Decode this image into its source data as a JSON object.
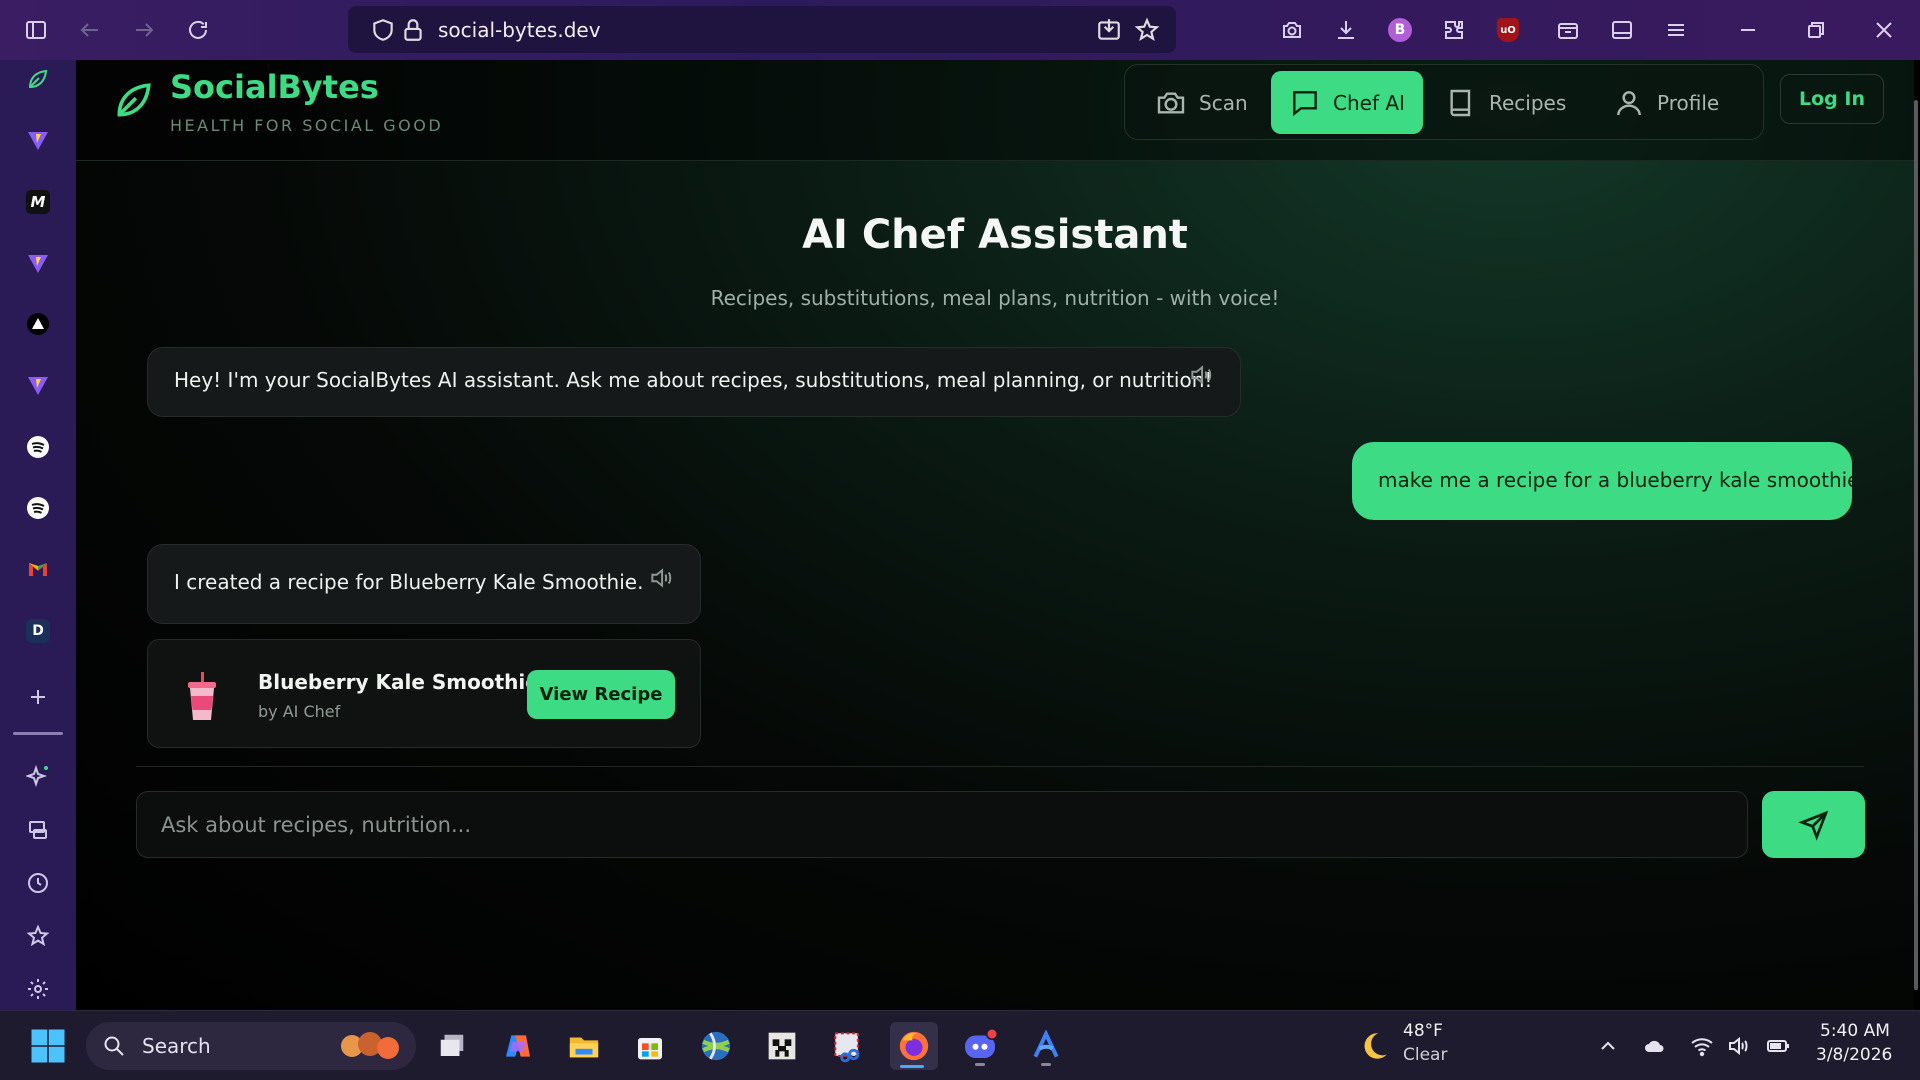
{
  "browser": {
    "url": "social-bytes.dev"
  },
  "app": {
    "brand": {
      "name": "SocialBytes",
      "tagline": "HEALTH FOR SOCIAL GOOD"
    },
    "nav": {
      "items": [
        {
          "label": "Scan",
          "icon": "camera-icon",
          "active": false
        },
        {
          "label": "Chef AI",
          "icon": "chat-icon",
          "active": true
        },
        {
          "label": "Recipes",
          "icon": "book-icon",
          "active": false
        },
        {
          "label": "Profile",
          "icon": "user-icon",
          "active": false
        }
      ],
      "login_label": "Log In"
    },
    "title": "AI Chef Assistant",
    "subtitle": "Recipes, substitutions, meal plans, nutrition - with voice!",
    "messages": [
      {
        "role": "assistant",
        "text": "Hey! I'm your SocialBytes AI assistant. Ask me about recipes, substitutions, meal planning, or nutrition!"
      },
      {
        "role": "user",
        "text": "make me a recipe for a blueberry kale smoothie"
      },
      {
        "role": "assistant",
        "text": "I created a recipe for Blueberry Kale Smoothie."
      }
    ],
    "recipe_card": {
      "title": "Blueberry Kale Smoothie",
      "author": "by AI Chef",
      "button": "View Recipe"
    },
    "input": {
      "placeholder": "Ask about recipes, nutrition...",
      "value": ""
    }
  },
  "taskbar": {
    "search_label": "Search",
    "weather": {
      "temp": "48°F",
      "condition": "Clear"
    },
    "clock": {
      "time": "5:40 AM",
      "date": "3/8/2026"
    }
  },
  "colors": {
    "accent": "#3ddc84",
    "background": "#050806",
    "browser_chrome": "#2c1b5c"
  }
}
